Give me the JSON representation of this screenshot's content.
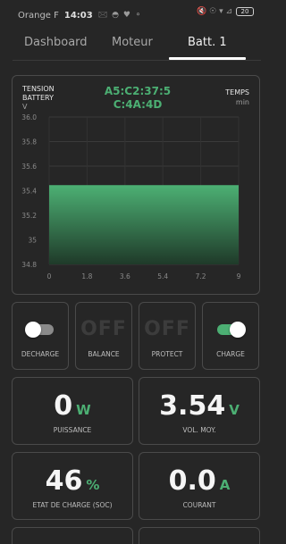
{
  "status_bar": {
    "carrier": "Orange F",
    "time": "14:03",
    "left_icons": "🖂 ◓ ♥ ⚬",
    "right_icons": "🔇 ☉ ▾ ⊿",
    "battery": "20"
  },
  "tabs": [
    {
      "label": "Dashboard"
    },
    {
      "label": "Moteur"
    },
    {
      "label": "Batt. 1"
    }
  ],
  "active_tab": "Batt. 1",
  "chart": {
    "y_title_line1": "TENSION",
    "y_title_line2": "BATTERY",
    "y_unit": "V",
    "center_line1": "A5:C2:37:5",
    "center_line2": "C:4A:4D",
    "x_title": "TEMPS",
    "x_unit": "min"
  },
  "chart_data": {
    "type": "area",
    "x": [
      0,
      9
    ],
    "values": [
      35.44,
      35.44
    ],
    "ylim": [
      34.8,
      36.0
    ],
    "xlim": [
      0,
      9
    ],
    "yticks": [
      "36.0",
      "35.8",
      "35.6",
      "35.4",
      "35.2",
      "35",
      "34.8"
    ],
    "xticks": [
      "0",
      "1.8",
      "3.6",
      "5.4",
      "7.2",
      "9"
    ],
    "ylabel": "TENSION BATTERY",
    "xlabel": "TEMPS",
    "grid": true,
    "color": "#4caf73"
  },
  "toggles": [
    {
      "label": "DECHARGE",
      "kind": "switch",
      "state": "off"
    },
    {
      "label": "BALANCE",
      "kind": "text",
      "text": "OFF"
    },
    {
      "label": "PROTECT",
      "kind": "text",
      "text": "OFF"
    },
    {
      "label": "CHARGE",
      "kind": "switch",
      "state": "on"
    }
  ],
  "metrics": [
    {
      "value": "0",
      "unit": "W",
      "label": "PUISSANCE"
    },
    {
      "value": "3.54",
      "unit": "V",
      "label": "VOL. MOY."
    },
    {
      "value": "46",
      "unit": "%",
      "label": "ETAT DE CHARGE (SOC)"
    },
    {
      "value": "0.0",
      "unit": "A",
      "label": "COURANT"
    }
  ],
  "colors": {
    "accent": "#4caf73",
    "background": "#262626",
    "card_border": "#4a4a4a"
  }
}
